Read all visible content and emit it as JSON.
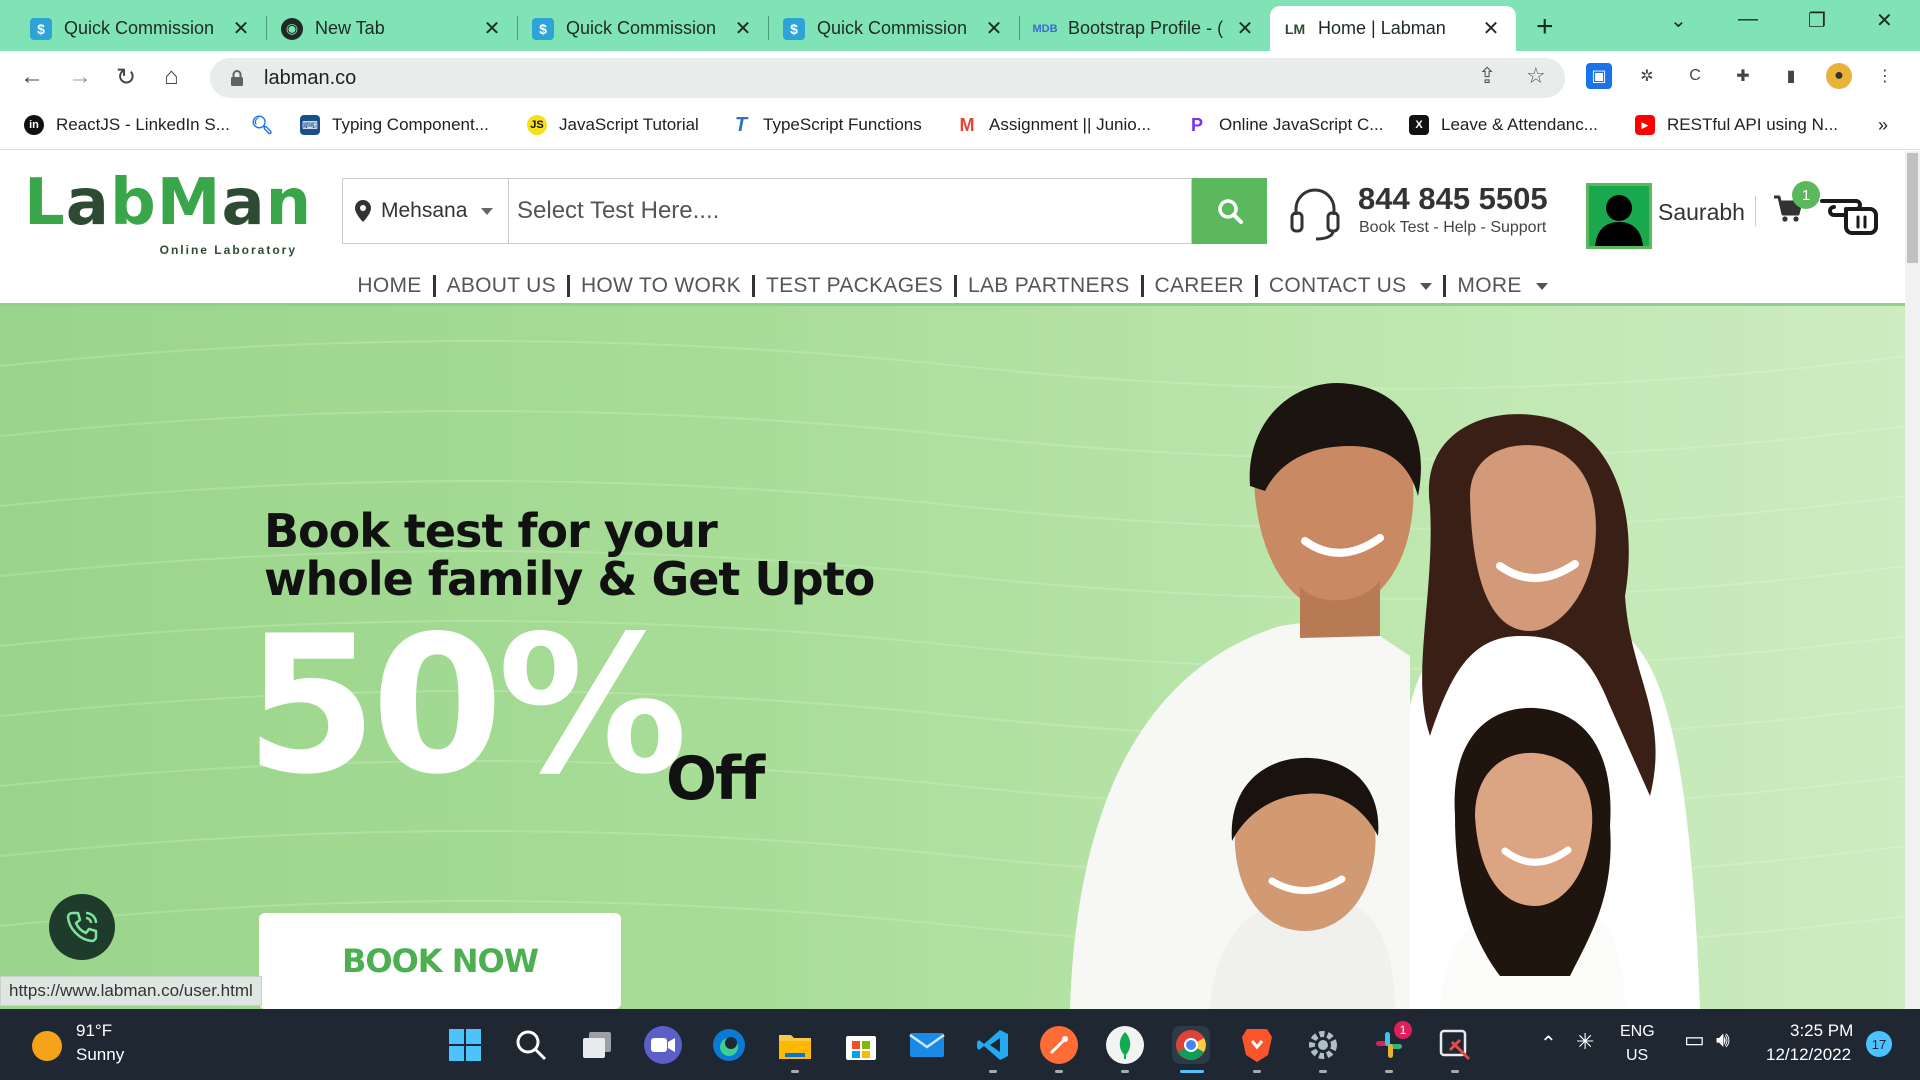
{
  "browser": {
    "tabs": [
      {
        "title": "Quick Commission",
        "favicon": "dollar-favicon",
        "active": false
      },
      {
        "title": "New Tab",
        "favicon": "chrome-favicon",
        "active": false
      },
      {
        "title": "Quick Commission",
        "favicon": "dollar-favicon",
        "active": false
      },
      {
        "title": "Quick Commission",
        "favicon": "dollar-favicon",
        "active": false
      },
      {
        "title": "Bootstrap Profile - (",
        "favicon": "mdb-favicon",
        "active": false
      },
      {
        "title": "Home | Labman",
        "favicon": "labman-favicon",
        "favicon_text": "LM",
        "active": true
      }
    ],
    "address": "labman.co",
    "bookmarks": [
      {
        "label": "ReactJS - LinkedIn S...",
        "icon": "linkedin-icon"
      },
      {
        "label": "",
        "icon": "search-icon"
      },
      {
        "label": "Typing Component...",
        "icon": "typing-icon"
      },
      {
        "label": "JavaScript Tutorial",
        "icon": "js-icon",
        "icon_text": "JS"
      },
      {
        "label": "TypeScript Functions",
        "icon": "ts-icon"
      },
      {
        "label": "Assignment || Junio...",
        "icon": "gmail-icon"
      },
      {
        "label": "Online JavaScript C...",
        "icon": "p-icon"
      },
      {
        "label": "Leave & Attendanc...",
        "icon": "x-icon"
      },
      {
        "label": "RESTful API using N...",
        "icon": "youtube-icon"
      }
    ],
    "more_bookmarks": "»",
    "status_url": "https://www.labman.co/user.html"
  },
  "site": {
    "logo": {
      "text_a": "L",
      "text_b": "a",
      "text_c": "bM",
      "text_d": "a",
      "text_e": "n",
      "tagline": "Online Laboratory"
    },
    "location": "Mehsana",
    "search_placeholder": "Select Test Here....",
    "support_phone": "844 845 5505",
    "support_label": "Book Test - Help - Support",
    "username": "Saurabh",
    "cart_count": "1",
    "nav": [
      {
        "label": "HOME"
      },
      {
        "label": "ABOUT US"
      },
      {
        "label": "HOW TO WORK"
      },
      {
        "label": "TEST PACKAGES"
      },
      {
        "label": "LAB PARTNERS"
      },
      {
        "label": "CAREER"
      },
      {
        "label": "CONTACT US",
        "dropdown": true
      },
      {
        "label": "MORE",
        "dropdown": true
      }
    ],
    "hero": {
      "line1": "Book test for your",
      "line2": "whole family & Get Upto",
      "percent": "50%",
      "off": "Off",
      "cta": "BOOK NOW"
    },
    "colors": {
      "brand_green": "#5cb85c",
      "hero_bg": "#a8dd98"
    }
  },
  "taskbar": {
    "weather_temp": "91°F",
    "weather_desc": "Sunny",
    "apps": [
      "start-icon",
      "search-icon",
      "task-view-icon",
      "teams-icon",
      "edge-icon",
      "file-explorer-icon",
      "store-icon",
      "mail-icon",
      "vscode-icon",
      "postman-icon",
      "mongodb-icon",
      "chrome-icon",
      "brave-icon",
      "settings-icon",
      "slack-icon",
      "snipping-tool-icon"
    ],
    "slack_badge": "1",
    "lang_top": "ENG",
    "lang_bottom": "US",
    "time": "3:25 PM",
    "date": "12/12/2022",
    "notification_count": "17"
  }
}
